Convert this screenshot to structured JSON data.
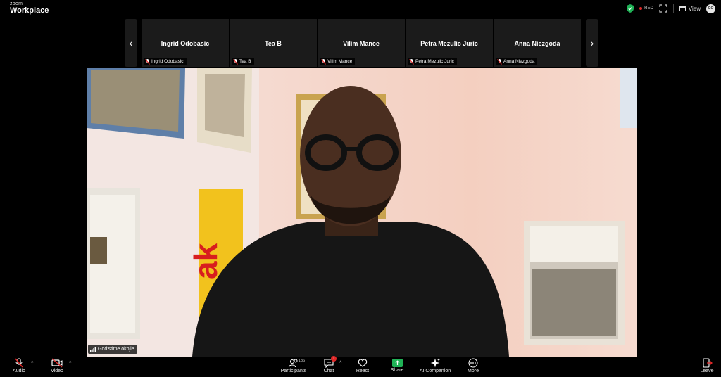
{
  "app": {
    "brand_small": "zoom",
    "brand_name": "Workplace"
  },
  "top_bar": {
    "rec_label": "REC",
    "view_label": "View",
    "avatar_initials": "GO"
  },
  "gallery": {
    "participants": [
      {
        "name": "Ingrid Odobasic",
        "label": "Ingrid Odobasic"
      },
      {
        "name": "Tea B",
        "label": "Tea B"
      },
      {
        "name": "Vilim Mance",
        "label": "Vilim Mance"
      },
      {
        "name": "Petra Mezulic Juric",
        "label": "Petra Mezulic Juric"
      },
      {
        "name": "Anna Niezgoda",
        "label": "Anna Niezgoda"
      }
    ]
  },
  "active_speaker": {
    "name": "God'stime okojie"
  },
  "toolbar": {
    "audio_label": "Audio",
    "video_label": "Video",
    "participants_label": "Participants",
    "participants_count": "136",
    "chat_label": "Chat",
    "chat_unread": "1",
    "react_label": "React",
    "share_label": "Share",
    "ai_label": "AI Companion",
    "more_label": "More",
    "leave_label": "Leave"
  },
  "colors": {
    "rec_dot": "#e02828",
    "share_green": "#1fb256",
    "shield_green": "#1fb256",
    "mute_red": "#e02828"
  }
}
